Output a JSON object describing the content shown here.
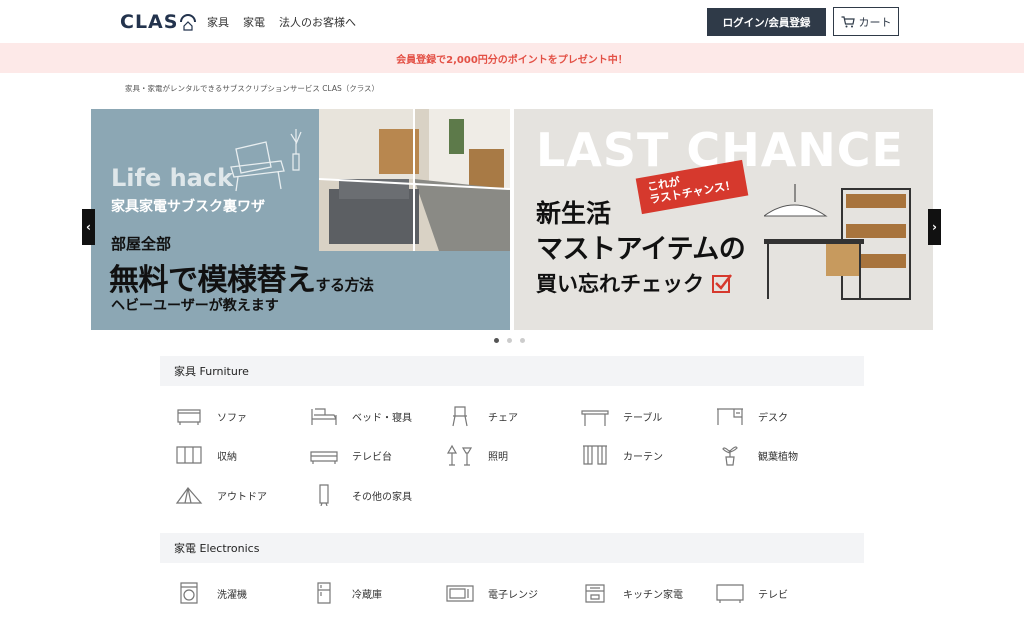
{
  "header": {
    "logo": "CLAS",
    "nav": [
      "家具",
      "家電",
      "法人のお客様へ"
    ],
    "login_label": "ログイン/会員登録",
    "cart_label": "カート"
  },
  "promo": {
    "text": "会員登録で2,000円分のポイントをプレゼント中！"
  },
  "breadcrumb": "家具・家電がレンタルできるサブスクリプションサービス CLAS（クラス）",
  "carousel": {
    "slide1": {
      "lifehack": "Life hack",
      "subtitle": "家具家電サブスク裏ワザ",
      "room": "部屋全部",
      "headline": "無料で模様替え",
      "headline_small": "する方法",
      "footer": "ヘビーユーザーが教えます"
    },
    "slide2": {
      "title": "LAST CHANCE",
      "badge_line1": "これが",
      "badge_line2": "ラストチャンス！",
      "line1": "新生活",
      "line2": "マストアイテムの",
      "line3": "買い忘れチェック"
    },
    "dots": 3,
    "active_dot": 0
  },
  "furniture": {
    "heading": "家具 Furniture",
    "items": [
      {
        "label": "ソファ",
        "icon": "sofa-icon"
      },
      {
        "label": "ベッド・寝具",
        "icon": "bed-icon"
      },
      {
        "label": "チェア",
        "icon": "chair-icon"
      },
      {
        "label": "テーブル",
        "icon": "table-icon"
      },
      {
        "label": "デスク",
        "icon": "desk-icon"
      },
      {
        "label": "収納",
        "icon": "storage-icon"
      },
      {
        "label": "テレビ台",
        "icon": "tv-stand-icon"
      },
      {
        "label": "照明",
        "icon": "lighting-icon"
      },
      {
        "label": "カーテン",
        "icon": "curtain-icon"
      },
      {
        "label": "観葉植物",
        "icon": "plant-icon"
      },
      {
        "label": "アウトドア",
        "icon": "tent-icon"
      },
      {
        "label": "その他の家具",
        "icon": "mirror-icon"
      }
    ]
  },
  "electronics": {
    "heading": "家電 Electronics",
    "items": [
      {
        "label": "洗濯機",
        "icon": "washing-machine-icon"
      },
      {
        "label": "冷蔵庫",
        "icon": "refrigerator-icon"
      },
      {
        "label": "電子レンジ",
        "icon": "microwave-icon"
      },
      {
        "label": "キッチン家電",
        "icon": "kitchen-appliance-icon"
      },
      {
        "label": "テレビ",
        "icon": "tv-icon"
      }
    ]
  }
}
